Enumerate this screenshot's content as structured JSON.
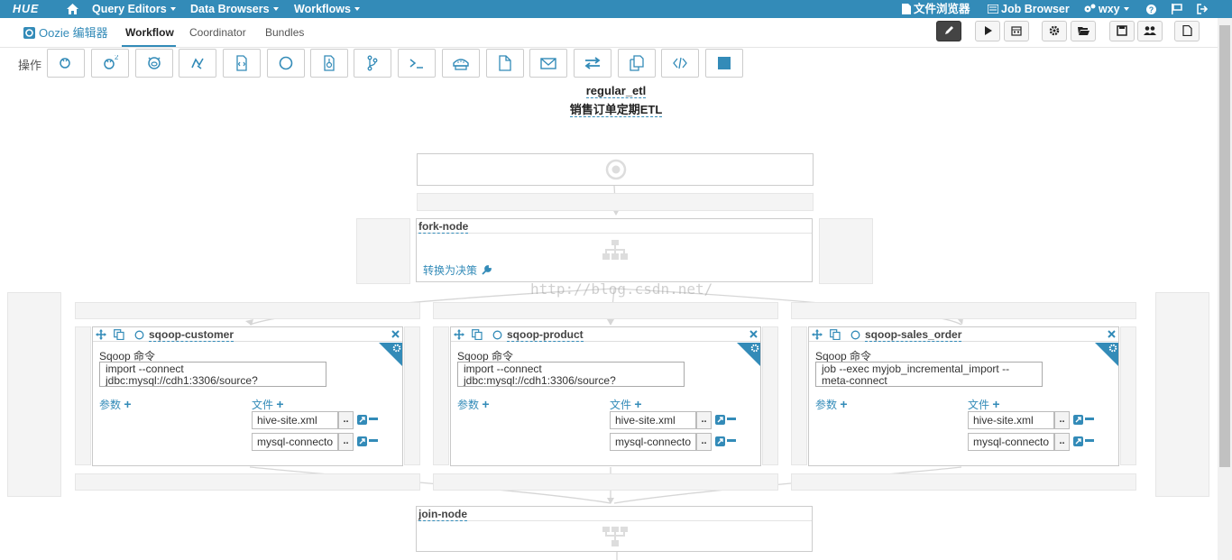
{
  "brand": "HUE",
  "nav": {
    "query_editors": "Query Editors",
    "data_browsers": "Data Browsers",
    "workflows": "Workflows",
    "file_browser": "文件浏览器",
    "job_browser": "Job Browser",
    "user": "wxy"
  },
  "app": {
    "name": "Oozie 编辑器",
    "tabs": [
      "Workflow",
      "Coordinator",
      "Bundles"
    ],
    "active_tab": "Workflow"
  },
  "actions_label": "操作",
  "workflow": {
    "name": "regular_etl",
    "description": "销售订单定期ETL"
  },
  "fork": {
    "name": "fork-node",
    "convert_label": "转换为决策"
  },
  "join": {
    "name": "join-node"
  },
  "sqoop_actions": [
    {
      "name": "sqoop-customer",
      "command_label": "Sqoop 命令",
      "command": "import --connect\njdbc:mysql://cdh1:3306/source?",
      "params_label": "参数",
      "files_label": "文件",
      "files": [
        "hive-site.xml",
        "mysql-connecto"
      ]
    },
    {
      "name": "sqoop-product",
      "command_label": "Sqoop 命令",
      "command": "import --connect\njdbc:mysql://cdh1:3306/source?",
      "params_label": "参数",
      "files_label": "文件",
      "files": [
        "hive-site.xml",
        "mysql-connecto"
      ]
    },
    {
      "name": "sqoop-sales_order",
      "command_label": "Sqoop 命令",
      "command": "job --exec myjob_incremental_import --\nmeta-connect",
      "params_label": "参数",
      "files_label": "文件",
      "files": [
        "hive-site.xml",
        "mysql-connecto"
      ]
    }
  ],
  "file_button_label": "..",
  "watermark": "http://blog.csdn.net/",
  "colors": {
    "accent": "#338bb8",
    "nav_bg": "#338bb8"
  }
}
